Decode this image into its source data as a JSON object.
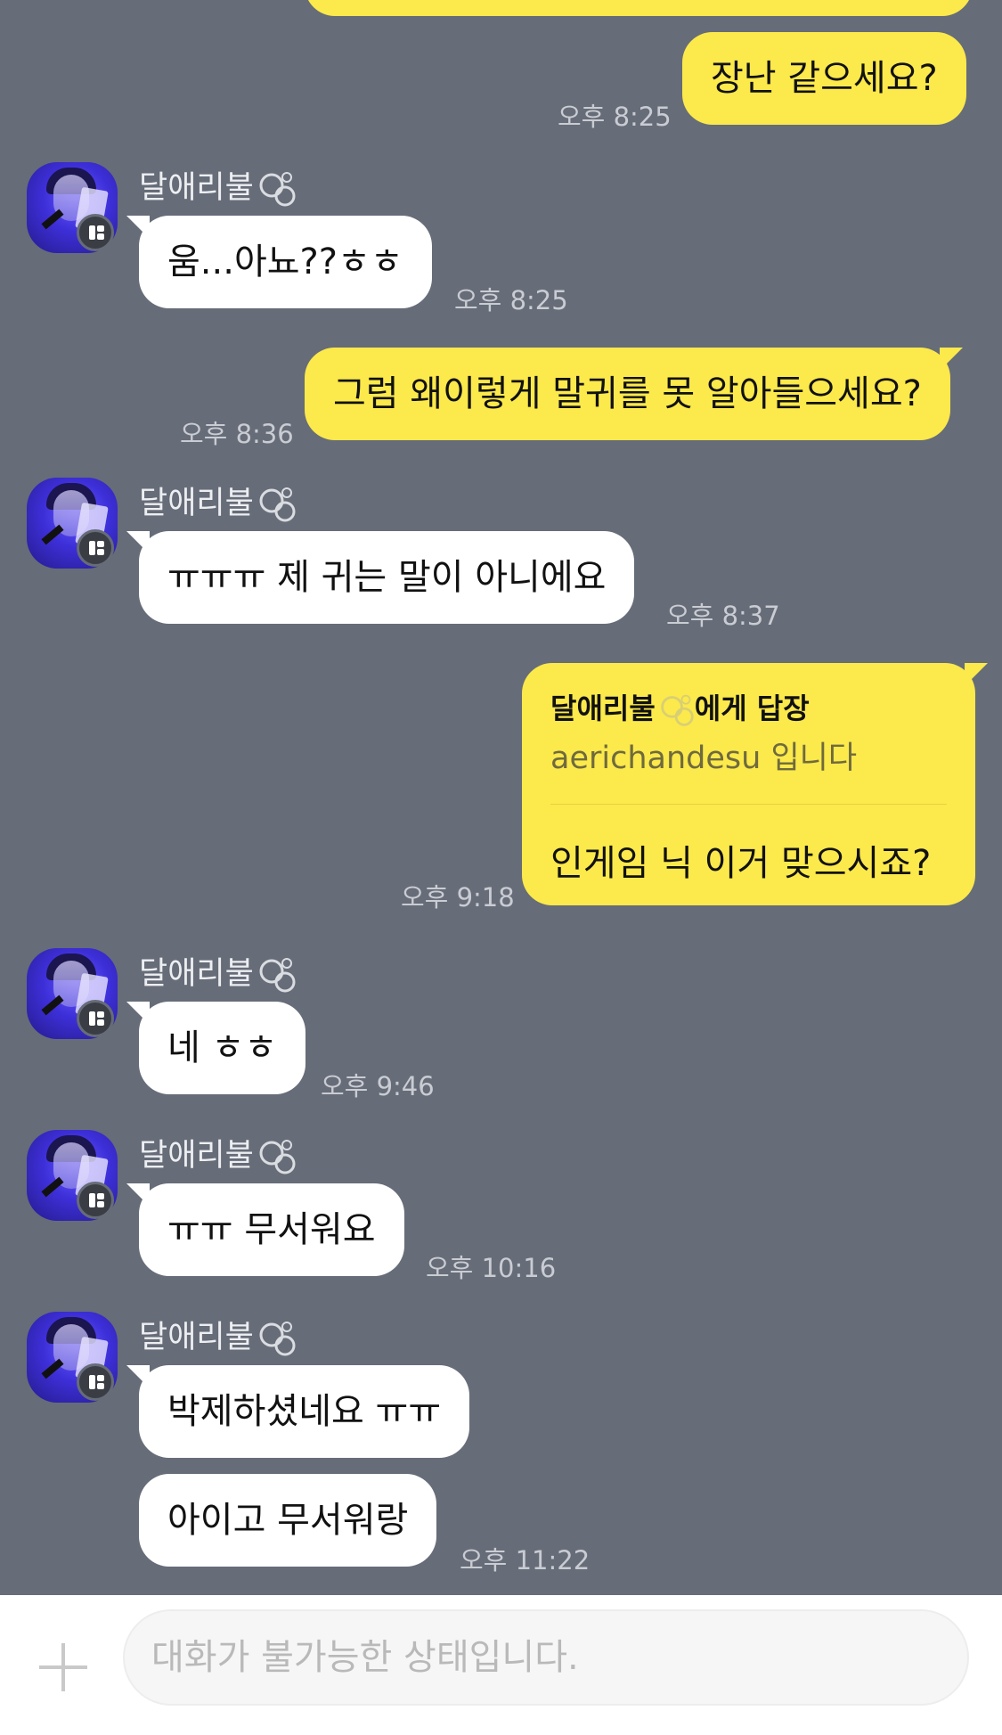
{
  "sender_name": "달애리불",
  "messages": [
    {
      "from": "me",
      "text": "장난 같으세요?",
      "time": "오후 8:25"
    },
    {
      "from": "them",
      "text": "움...아뇨??ㅎㅎ",
      "time": "오후 8:25"
    },
    {
      "from": "me",
      "text": "그럼 왜이렇게 말귀를 못 알아들으세요?",
      "time": "오후 8:36"
    },
    {
      "from": "them",
      "text": "ㅠㅠㅠ 제 귀는 말이 아니에요",
      "time": "오후 8:37"
    },
    {
      "from": "me",
      "type": "reply",
      "reply_to": "에게 답장",
      "reply_quote": "aerichandesu 입니다",
      "text": "인게임 닉 이거 맞으시죠?",
      "time": "오후 9:18"
    },
    {
      "from": "them",
      "text": "네 ㅎㅎ",
      "time": "오후 9:46"
    },
    {
      "from": "them",
      "text": "ㅠㅠ 무서워요",
      "time": "오후 10:16"
    },
    {
      "from": "them",
      "text": "박제하셨네요 ㅠㅠ",
      "time": ""
    },
    {
      "from": "them",
      "text": "아이고 무서워랑",
      "time": "오후 11:22"
    }
  ],
  "input": {
    "placeholder": "대화가 불가능한 상태입니다."
  },
  "colors": {
    "background": "#666c78",
    "my_bubble": "#fce94b",
    "their_bubble": "#ffffff"
  }
}
